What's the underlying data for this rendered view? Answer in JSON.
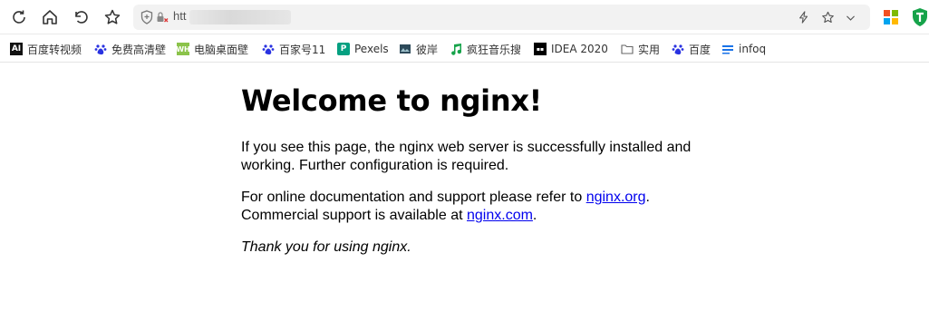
{
  "browser": {
    "url_visible": "htt",
    "icons": {
      "refresh": "refresh-icon",
      "home": "home-icon",
      "undo": "undo-icon",
      "favorite": "star-icon",
      "security": "shield-icon",
      "insecure": "insecure-lock-icon",
      "lightning": "lightning-icon",
      "bookmark_star": "star-icon",
      "dropdown": "chevron-down-icon",
      "extensions": "windows-grid-icon",
      "extension_shield": "green-shield-icon"
    }
  },
  "bookmarks": [
    {
      "label": "百度转视频",
      "icon": "AI"
    },
    {
      "label": "免费高清壁",
      "icon": "paw"
    },
    {
      "label": "电脑桌面壁",
      "icon": "WH"
    },
    {
      "label": "百家号11",
      "icon": "paw"
    },
    {
      "label": "Pexels",
      "icon": "P"
    },
    {
      "label": "彼岸",
      "icon": "bian"
    },
    {
      "label": "疯狂音乐搜",
      "icon": "music"
    },
    {
      "label": "IDEA 2020",
      "icon": "idea"
    },
    {
      "label": "实用",
      "icon": "folder"
    },
    {
      "label": "百度",
      "icon": "paw"
    },
    {
      "label": "infoq",
      "icon": "infoq"
    }
  ],
  "page": {
    "title": "Welcome to nginx!",
    "p1": "If you see this page, the nginx web server is successfully installed and working. Further configuration is required.",
    "p2_pre": "For online documentation and support please refer to ",
    "p2_link1": "nginx.org",
    "p2_mid": ".",
    "p2_line2": "Commercial support is available at ",
    "p2_link2": "nginx.com",
    "p2_end": ".",
    "p3": "Thank you for using nginx."
  },
  "colors": {
    "link": "#0000ee",
    "baidu_blue": "#2932e1",
    "green_ext": "#16a34a"
  }
}
